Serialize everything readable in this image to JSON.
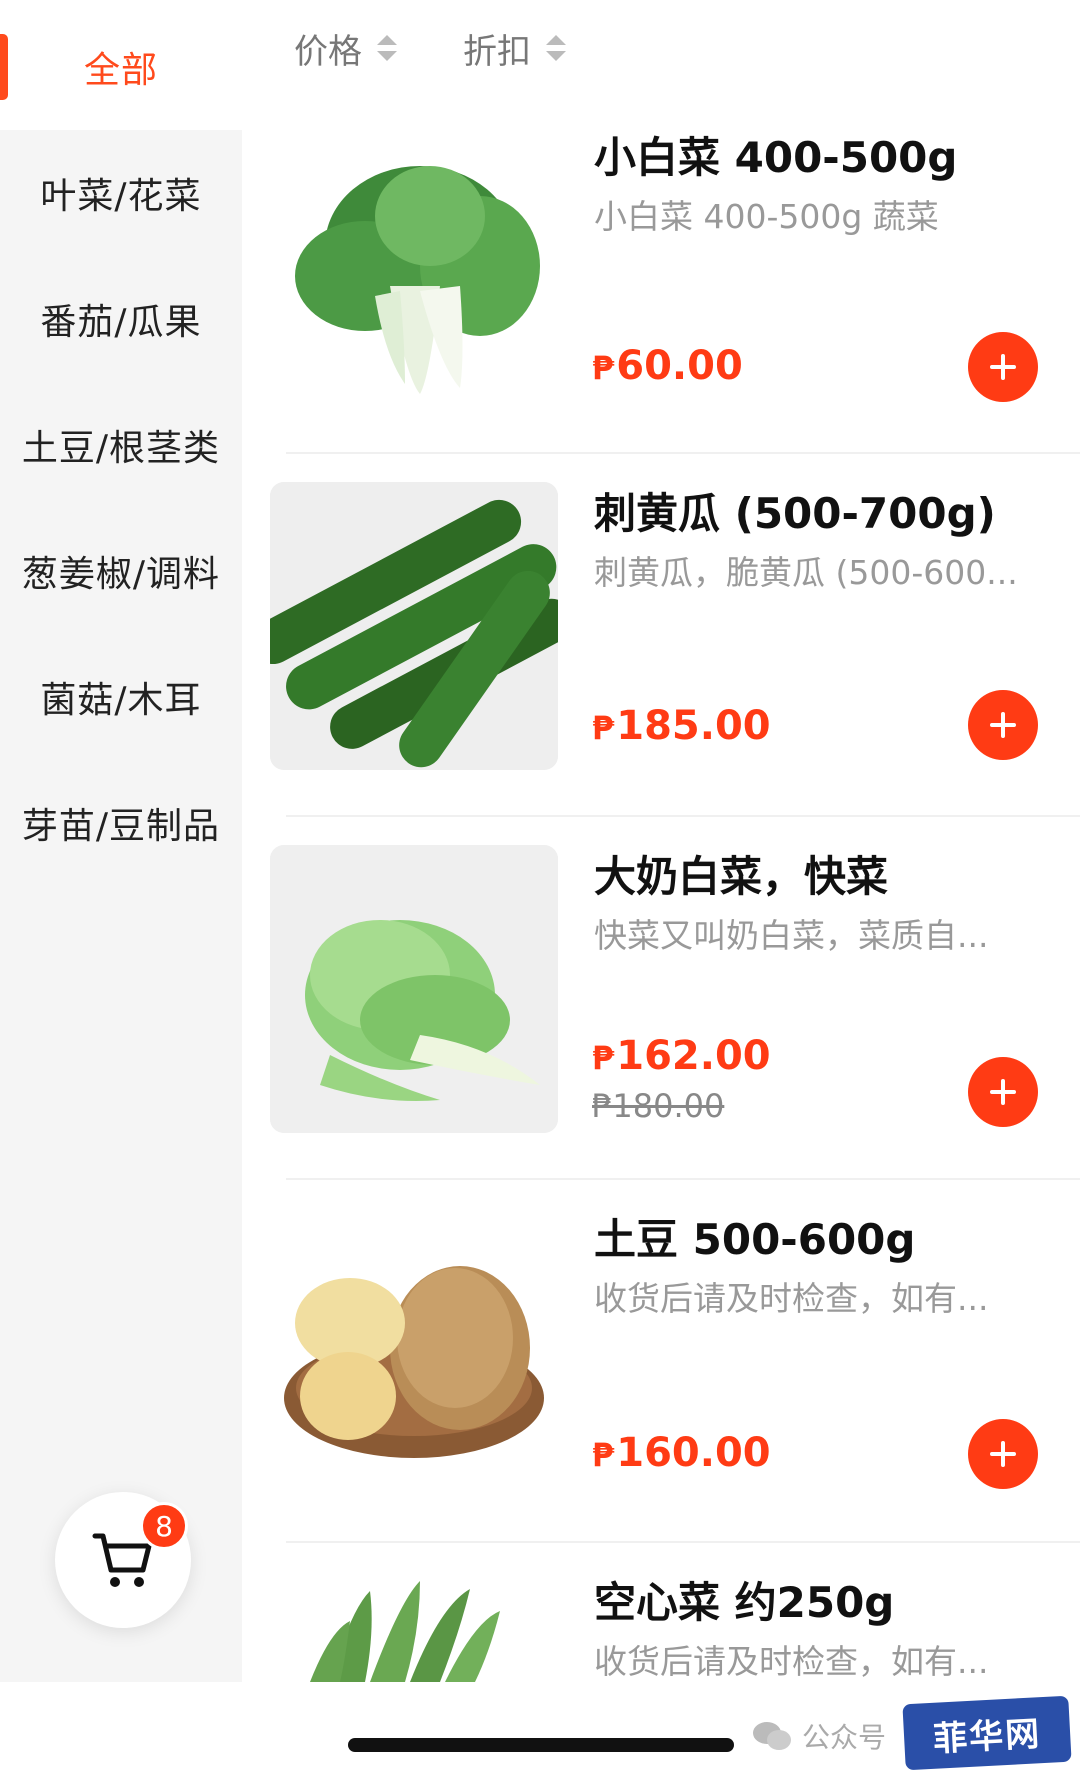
{
  "sort_bar": {
    "price_label": "价格",
    "discount_label": "折扣"
  },
  "categories": [
    {
      "label": "全部",
      "active": true
    },
    {
      "label": "叶菜/花菜",
      "active": false
    },
    {
      "label": "番茄/瓜果",
      "active": false
    },
    {
      "label": "土豆/根茎类",
      "active": false
    },
    {
      "label": "葱姜椒/调料",
      "active": false
    },
    {
      "label": "菌菇/木耳",
      "active": false
    },
    {
      "label": "芽苗/豆制品",
      "active": false
    }
  ],
  "products": [
    {
      "title": "小白菜 400-500g",
      "desc": "小白菜 400-500g   蔬菜",
      "currency": "₱",
      "price": "60.00",
      "image": "bok-choy-image"
    },
    {
      "title": "刺黄瓜 (500-700g)",
      "desc": "刺黄瓜，脆黄瓜 (500-600...",
      "currency": "₱",
      "price": "185.00",
      "image": "cucumber-image"
    },
    {
      "title": "大奶白菜，快菜",
      "desc": "快菜又叫奶白菜，菜质自...",
      "currency": "₱",
      "price": "162.00",
      "old_price": "₱180.00",
      "image": "napa-cabbage-image"
    },
    {
      "title": "土豆 500-600g",
      "desc": "收货后请及时检查，如有...",
      "currency": "₱",
      "price": "160.00",
      "image": "potato-image"
    },
    {
      "title": "空心菜 约250g",
      "desc": "收货后请及时检查，如有...",
      "image": "water-spinach-image"
    }
  ],
  "cart": {
    "badge_count": "8",
    "icon": "cart-icon"
  },
  "footer": {
    "wechat_label": "公众号",
    "site_logo_text": "菲华网"
  },
  "colors": {
    "accent": "#ff3b14",
    "sidebar_bg": "#f5f5f5",
    "muted_text": "#999999"
  }
}
